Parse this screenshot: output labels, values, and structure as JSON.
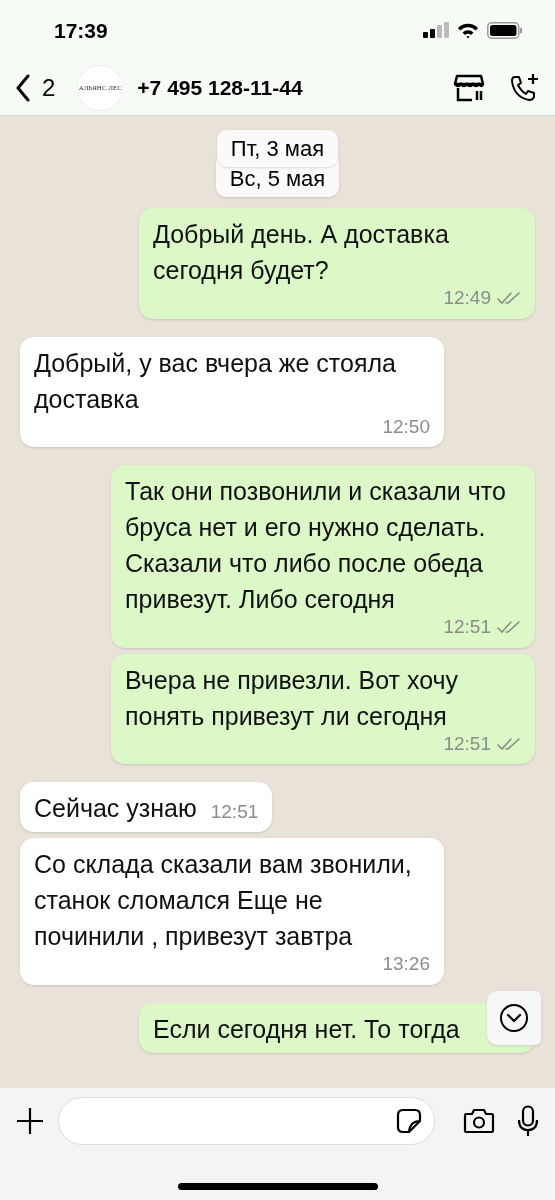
{
  "status_bar": {
    "time": "17:39"
  },
  "header": {
    "back_count": "2",
    "avatar_text": "АЛЬЯНС ЛЕС",
    "contact": "+7 495 128-11-44"
  },
  "date_pills": [
    "Пт, 3 мая",
    "Вс, 5 мая"
  ],
  "messages": [
    {
      "kind": "out",
      "text": "Добрый день. А доставка сегодня будет?",
      "time": "12:49",
      "read": false
    },
    {
      "kind": "in",
      "text": "Добрый, у вас вчера же стояла доставка",
      "time": "12:50"
    },
    {
      "kind": "out",
      "text": "Так они позвонили и сказали что бруса нет и его нужно сделать. Сказали что либо после обеда привезут. Либо сегодня",
      "time": "12:51",
      "read": false
    },
    {
      "kind": "out",
      "text": "Вчера не привезли. Вот хочу понять привезут ли сегодня",
      "time": "12:51",
      "read": false
    },
    {
      "kind": "in",
      "text": "Сейчас узнаю",
      "time": "12:51"
    },
    {
      "kind": "in",
      "text": "Со склада сказали вам звонили, станок сломался Еще не починили , привезут завтра",
      "time": "13:26"
    },
    {
      "kind": "out",
      "text": "Если сегодня нет. То тогда"
    }
  ]
}
